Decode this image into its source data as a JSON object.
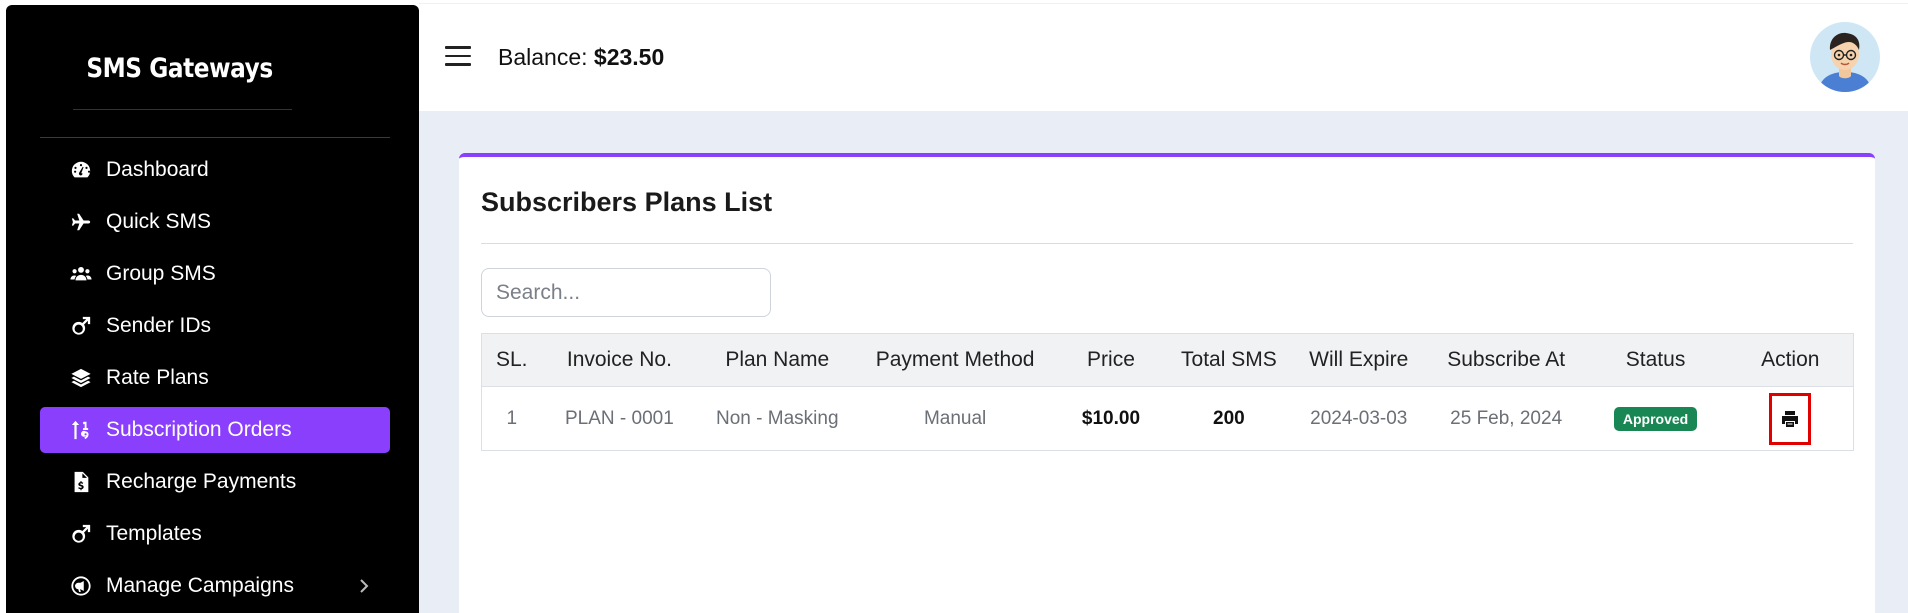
{
  "sidebar": {
    "brand": "SMS Gateways",
    "items": [
      {
        "label": "Dashboard",
        "icon": "dashboard-gauge-icon"
      },
      {
        "label": "Quick SMS",
        "icon": "plane-icon"
      },
      {
        "label": "Group SMS",
        "icon": "users-icon"
      },
      {
        "label": "Sender IDs",
        "icon": "mars-icon"
      },
      {
        "label": "Rate Plans",
        "icon": "layers-icon"
      },
      {
        "label": "Subscription Orders",
        "icon": "sort-numeric-icon",
        "active": true
      },
      {
        "label": "Recharge Payments",
        "icon": "invoice-dollar-icon"
      },
      {
        "label": "Templates",
        "icon": "mars-icon"
      },
      {
        "label": "Manage Campaigns",
        "icon": "campaign-icon",
        "has_submenu": true
      }
    ]
  },
  "topbar": {
    "balance_label": "Balance:",
    "balance_value": "$23.50"
  },
  "card": {
    "title": "Subscribers Plans List",
    "search_placeholder": "Search..."
  },
  "table": {
    "headers": [
      "SL.",
      "Invoice No.",
      "Plan Name",
      "Payment Method",
      "Price",
      "Total SMS",
      "Will Expire",
      "Subscribe At",
      "Status",
      "Action"
    ],
    "rows": [
      {
        "sl": "1",
        "invoice": "PLAN - 0001",
        "plan": "Non - Masking",
        "method": "Manual",
        "price": "$10.00",
        "total_sms": "200",
        "expire": "2024-03-03",
        "subscribed": "25 Feb, 2024",
        "status": "Approved"
      }
    ]
  },
  "colors": {
    "accent": "#8a3ffc",
    "status_approved": "#198754",
    "highlight": "#e00000"
  }
}
